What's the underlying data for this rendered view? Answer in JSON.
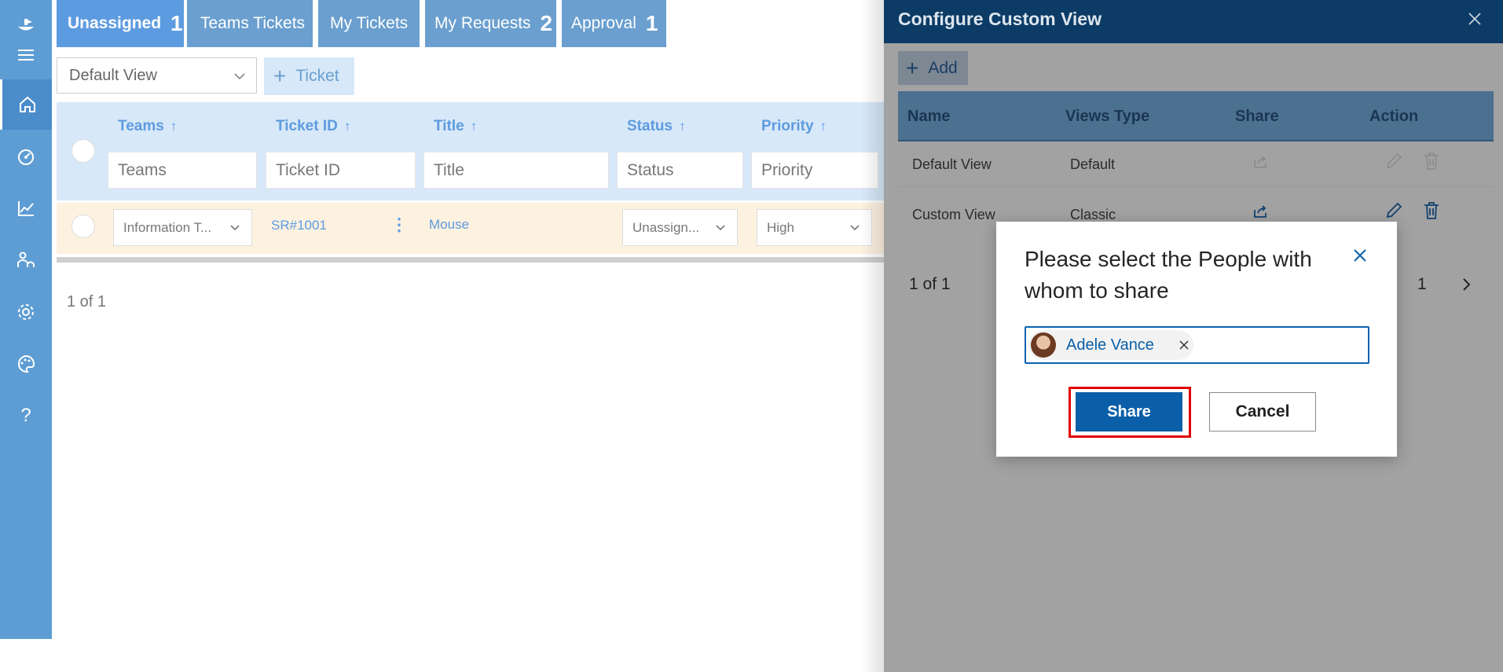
{
  "tabs": [
    {
      "label": "Unassigned",
      "badge": "1"
    },
    {
      "label": "Teams Tickets",
      "badge": ""
    },
    {
      "label": "My Tickets",
      "badge": ""
    },
    {
      "label": "My Requests",
      "badge": "2"
    },
    {
      "label": "Approval",
      "badge": "1"
    }
  ],
  "toolbar": {
    "view_select_value": "Default View",
    "ticket_button_label": "Ticket",
    "plus_glyph": "+"
  },
  "grid": {
    "columns": [
      {
        "label": "Teams",
        "filter_placeholder": "Teams"
      },
      {
        "label": "Ticket ID",
        "filter_placeholder": "Ticket ID"
      },
      {
        "label": "Title",
        "filter_placeholder": "Title"
      },
      {
        "label": "Status",
        "filter_placeholder": "Status"
      },
      {
        "label": "Priority",
        "filter_placeholder": "Priority"
      }
    ],
    "sort_glyph": "↑",
    "rows": [
      {
        "team": "Information T...",
        "ticket_id": "SR#1001",
        "title": "Mouse",
        "status": "Unassign...",
        "priority": "High"
      }
    ],
    "pager": "1 of 1"
  },
  "sidebar": {
    "items": [
      "logo-icon",
      "menu-icon",
      "home-icon",
      "dashboard-icon",
      "analytics-icon",
      "people-icon",
      "settings-icon",
      "palette-icon",
      "help-icon"
    ],
    "help_glyph": "?"
  },
  "panel": {
    "title": "Configure Custom View",
    "add_label": "Add",
    "columns": [
      "Name",
      "Views Type",
      "Share",
      "Action"
    ],
    "rows": [
      {
        "name": "Default View",
        "type": "Default"
      },
      {
        "name": "Custom View",
        "type": "Classic"
      }
    ],
    "pager_text": "1 of 1",
    "page_number": "1"
  },
  "modal": {
    "title": "Please select the People with whom to share",
    "selected_person": "Adele Vance",
    "share_label": "Share",
    "cancel_label": "Cancel"
  },
  "colors": {
    "sidebar": "#5e9dd3",
    "tab_active": "#5d9be0",
    "panel_header": "#0c3b66",
    "primary_button": "#0a5fa8",
    "highlight": "#e00000"
  }
}
